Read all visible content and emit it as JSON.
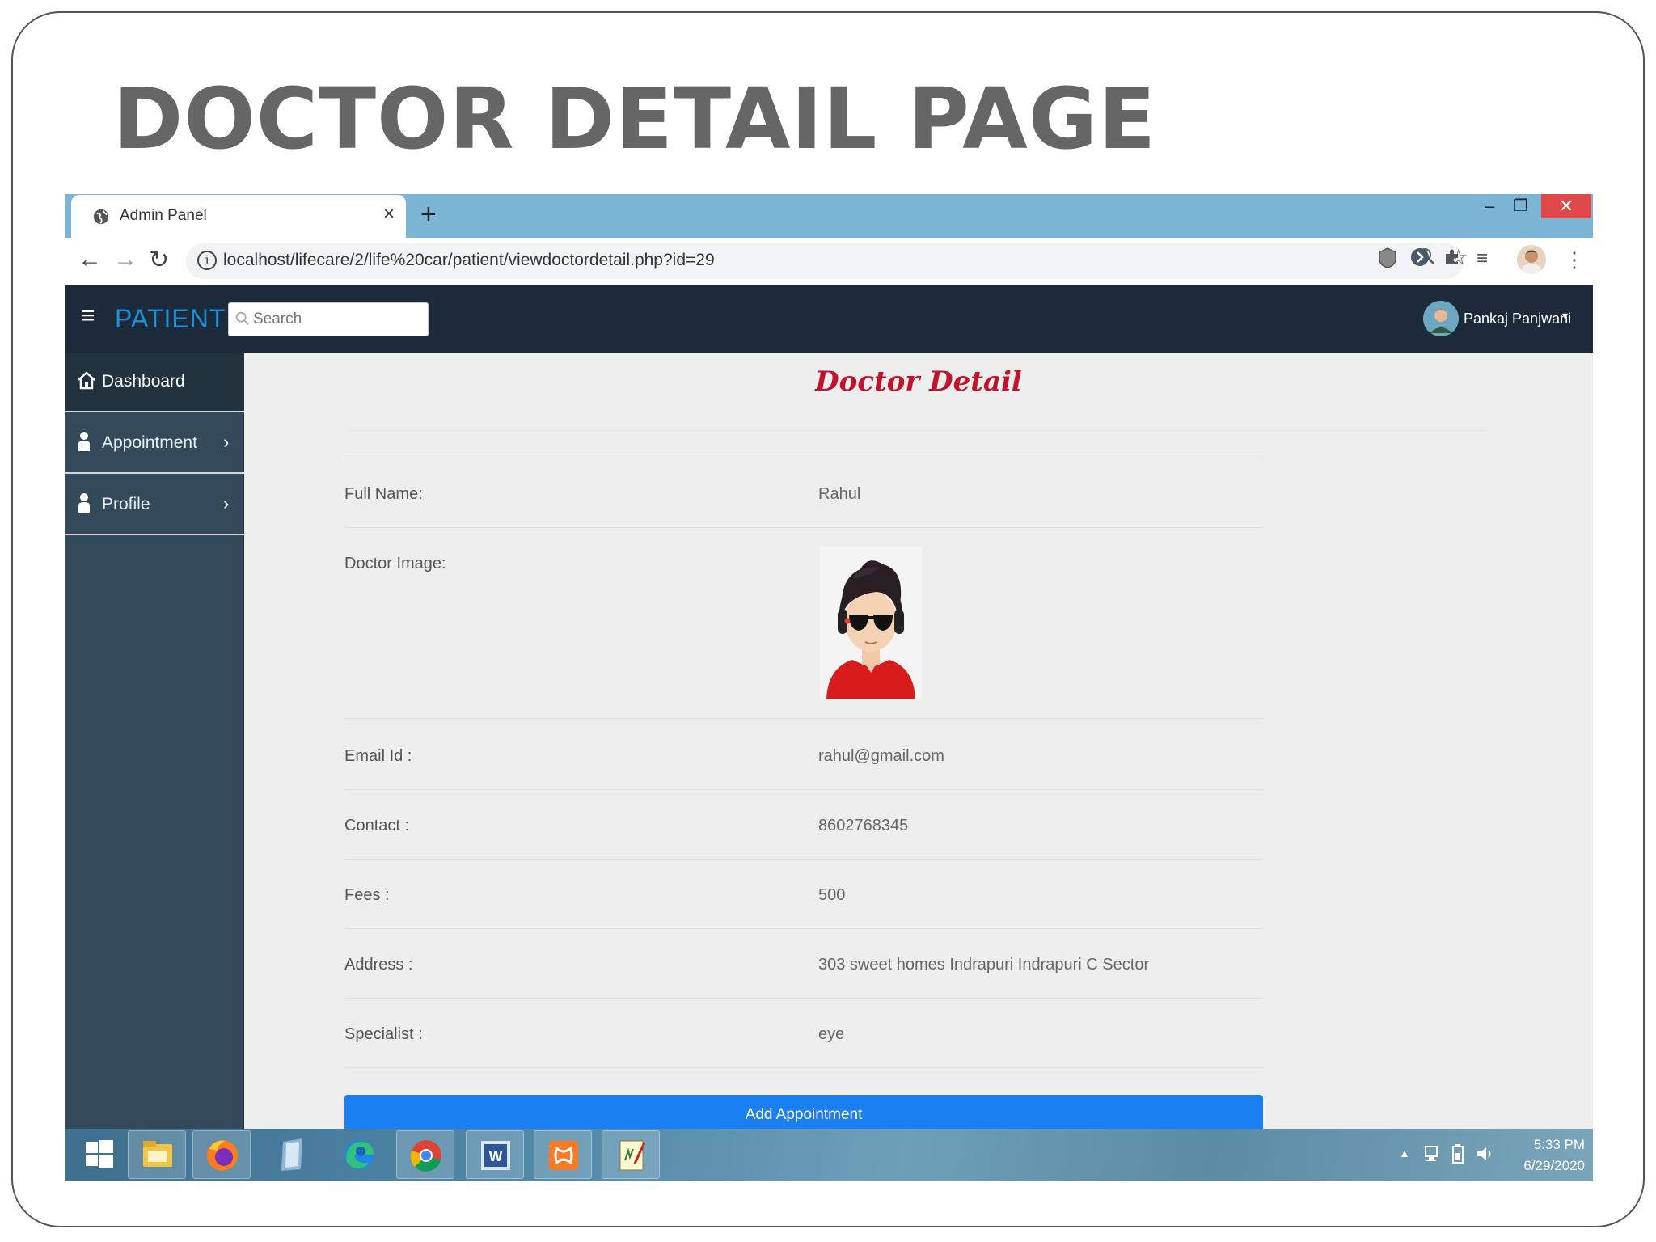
{
  "slide": {
    "title": "DOCTOR DETAIL PAGE"
  },
  "browser": {
    "tab_title": "Admin Panel",
    "tab_close": "×",
    "new_tab": "+",
    "url": "localhost/lifecare/2/life%20car/patient/viewdoctordetail.php?id=29",
    "window_controls": {
      "minimize": "–",
      "restore": "❐",
      "close": "✕"
    }
  },
  "app": {
    "brand": "PATIENT",
    "search_placeholder": "Search",
    "user_name": "Pankaj Panjwani"
  },
  "sidebar": {
    "items": [
      {
        "label": "Dashboard",
        "icon": "home-icon",
        "active": true
      },
      {
        "label": "Appointment",
        "icon": "user-icon",
        "has_submenu": true
      },
      {
        "label": "Profile",
        "icon": "user-icon",
        "has_submenu": true
      }
    ]
  },
  "main": {
    "heading": "Doctor Detail",
    "fields": [
      {
        "label": "Full Name:",
        "value": "Rahul"
      },
      {
        "label": "Doctor Image:",
        "value": ""
      },
      {
        "label": "Email Id :",
        "value": "rahul@gmail.com"
      },
      {
        "label": "Contact :",
        "value": "8602768345"
      },
      {
        "label": "Fees :",
        "value": "500"
      },
      {
        "label": "Address :",
        "value": "303 sweet homes Indrapuri Indrapuri C Sector"
      },
      {
        "label": "Specialist :",
        "value": "eye"
      }
    ],
    "button_label": "Add Appointment"
  },
  "taskbar": {
    "apps": [
      "windows-start",
      "file-explorer",
      "firefox",
      "notepad",
      "edge",
      "chrome",
      "word",
      "xampp",
      "editor"
    ],
    "time": "5:33 PM",
    "date": "6/29/2020"
  },
  "colors": {
    "tab_strip": "#7bb4d4",
    "header_bg": "#1c2a3a",
    "brand": "#1f8fd6",
    "sidebar_bg": "#344a5b",
    "heading": "#c4122a",
    "button": "#1a7ff0"
  }
}
